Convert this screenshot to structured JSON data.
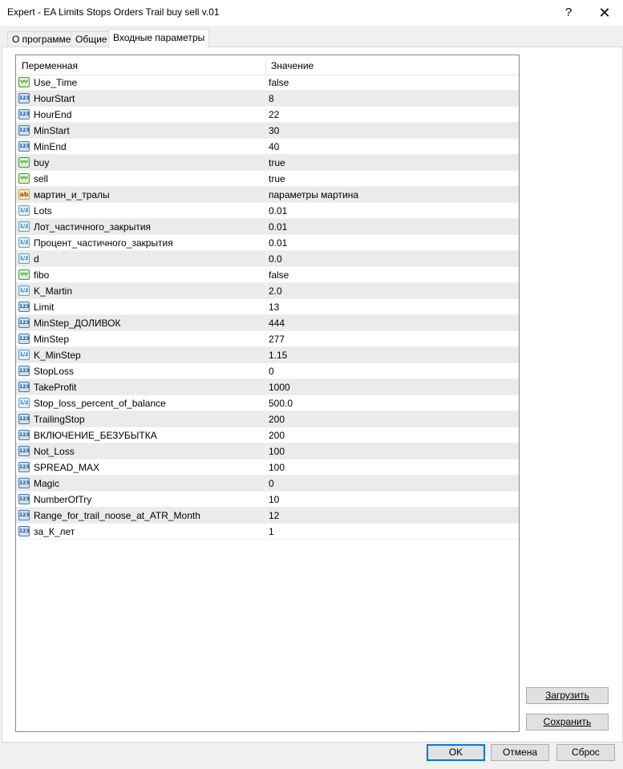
{
  "window": {
    "title": "Expert - EA Limits Stops Orders Trail buy sell v.01",
    "help": "?",
    "close": "✕"
  },
  "tabs": [
    {
      "label": "О программе"
    },
    {
      "label": "Общие"
    },
    {
      "label": "Входные параметры"
    }
  ],
  "grid": {
    "col_variable": "Переменная",
    "col_value": "Значение",
    "rows": [
      {
        "name": "Use_Time",
        "value": "false",
        "type": "bool"
      },
      {
        "name": "HourStart",
        "value": "8",
        "type": "int"
      },
      {
        "name": "HourEnd",
        "value": "22",
        "type": "int"
      },
      {
        "name": "MinStart",
        "value": "30",
        "type": "int"
      },
      {
        "name": "MinEnd",
        "value": "40",
        "type": "int"
      },
      {
        "name": "buy",
        "value": "true",
        "type": "bool"
      },
      {
        "name": "sell",
        "value": "true",
        "type": "bool"
      },
      {
        "name": "мартин_и_тралы",
        "value": " параметры мартина",
        "type": "str"
      },
      {
        "name": "Lots",
        "value": "0.01",
        "type": "dbl"
      },
      {
        "name": "Лот_частичного_закрытия",
        "value": "0.01",
        "type": "dbl"
      },
      {
        "name": "Процент_частичного_закрытия",
        "value": "0.01",
        "type": "dbl"
      },
      {
        "name": "d",
        "value": "0.0",
        "type": "dbl"
      },
      {
        "name": "fibo",
        "value": "false",
        "type": "bool"
      },
      {
        "name": "K_Martin",
        "value": "2.0",
        "type": "dbl"
      },
      {
        "name": "Limit",
        "value": "13",
        "type": "int"
      },
      {
        "name": "MinStep_ДОЛИВОК",
        "value": "444",
        "type": "int"
      },
      {
        "name": "MinStep",
        "value": "277",
        "type": "int"
      },
      {
        "name": "K_MinStep",
        "value": "1.15",
        "type": "dbl"
      },
      {
        "name": "StopLoss",
        "value": "0",
        "type": "int"
      },
      {
        "name": "TakeProfit",
        "value": "1000",
        "type": "int"
      },
      {
        "name": "Stop_loss_percent_of_balance",
        "value": "500.0",
        "type": "dbl"
      },
      {
        "name": "TrailingStop",
        "value": "200",
        "type": "int"
      },
      {
        "name": "ВКЛЮЧЕНИЕ_БЕЗУБЫТКА",
        "value": "200",
        "type": "int"
      },
      {
        "name": "Not_Loss",
        "value": "100",
        "type": "int"
      },
      {
        "name": "SPREAD_MAX",
        "value": "100",
        "type": "int"
      },
      {
        "name": "Magic",
        "value": "0",
        "type": "int"
      },
      {
        "name": "NumberOfTry",
        "value": "10",
        "type": "int"
      },
      {
        "name": "Range_for_trail_noose_at_ATR_Month",
        "value": "12",
        "type": "int"
      },
      {
        "name": "за_К_лет",
        "value": "1",
        "type": "int"
      }
    ]
  },
  "icon_glyphs": {
    "bool": "〰",
    "int": "123",
    "dbl": "1/2",
    "str": "ab"
  },
  "buttons": {
    "load": "Загрузить",
    "save": "Сохранить",
    "ok": "OK",
    "cancel": "Отмена",
    "reset": "Сброс"
  }
}
